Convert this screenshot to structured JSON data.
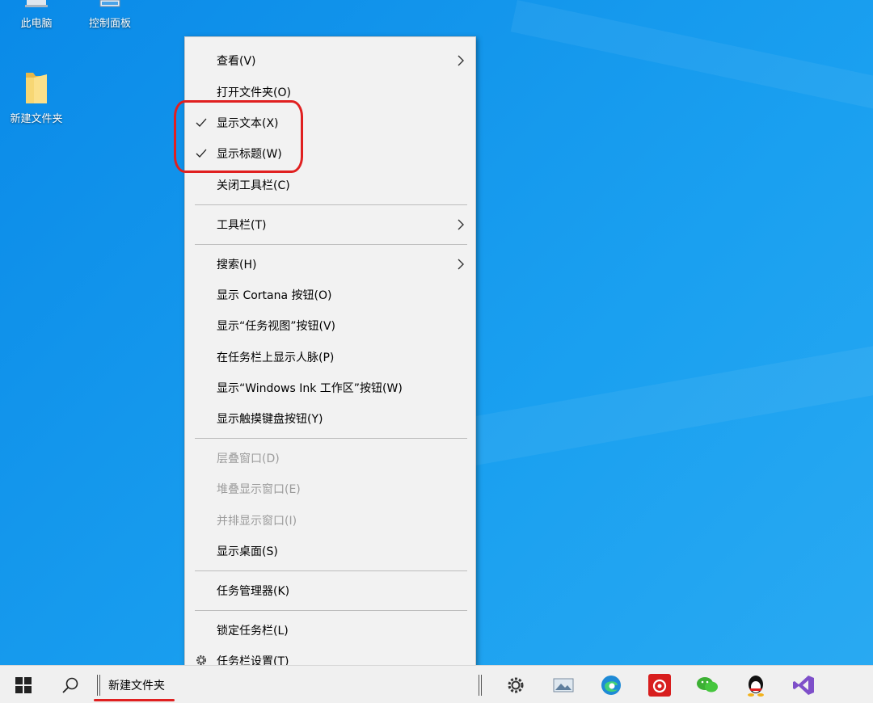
{
  "desktop": {
    "icons": [
      {
        "label": "此电脑"
      },
      {
        "label": "控制面板"
      },
      {
        "label": "新建文件夹"
      }
    ]
  },
  "context_menu": {
    "items": [
      {
        "label": "查看(V)",
        "submenu": true
      },
      {
        "label": "打开文件夹(O)"
      },
      {
        "label": "显示文本(X)",
        "checked": true
      },
      {
        "label": "显示标题(W)",
        "checked": true
      },
      {
        "label": "关闭工具栏(C)"
      },
      {
        "label": "工具栏(T)",
        "submenu": true
      },
      {
        "label": "搜索(H)",
        "submenu": true
      },
      {
        "label": "显示 Cortana 按钮(O)"
      },
      {
        "label": "显示“任务视图”按钮(V)"
      },
      {
        "label": "在任务栏上显示人脉(P)"
      },
      {
        "label": "显示“Windows Ink 工作区”按钮(W)"
      },
      {
        "label": "显示触摸键盘按钮(Y)"
      },
      {
        "label": "层叠窗口(D)",
        "disabled": true
      },
      {
        "label": "堆叠显示窗口(E)",
        "disabled": true
      },
      {
        "label": "并排显示窗口(I)",
        "disabled": true
      },
      {
        "label": "显示桌面(S)"
      },
      {
        "label": "任务管理器(K)"
      },
      {
        "label": "锁定任务栏(L)"
      },
      {
        "label": "任务栏设置(T)",
        "icon": "gear-icon"
      }
    ]
  },
  "taskbar": {
    "toolbar_label": "新建文件夹",
    "icons": [
      "start-icon",
      "search-icon",
      "settings-icon",
      "photos-icon",
      "edge-icon",
      "netease-music-icon",
      "wechat-icon",
      "qq-icon",
      "visual-studio-icon"
    ]
  },
  "colors": {
    "desktop_blue": "#1497ec",
    "menu_bg": "#f2f2f2",
    "annotation_red": "#e02020"
  }
}
